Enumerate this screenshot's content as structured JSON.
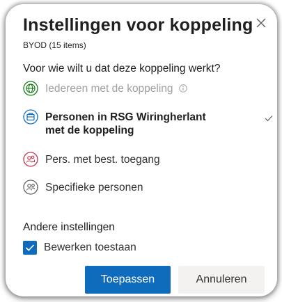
{
  "dialog": {
    "title": "Instellingen voor koppeling",
    "subtitle": "BYOD (15 items)",
    "close_icon": "close-icon"
  },
  "audience": {
    "question": "Voor wie wilt u dat deze koppeling werkt?",
    "options": [
      {
        "label": "Iedereen met de koppeling",
        "icon": "globe-icon",
        "state": "disabled",
        "has_info": true
      },
      {
        "label_line1": "Personen in RSG Wiringherlant",
        "label_line2": "met de koppeling",
        "icon": "building-icon",
        "state": "selected"
      },
      {
        "label": "Pers. met best. toegang",
        "icon": "people-access-icon",
        "state": "enabled"
      },
      {
        "label": "Specifieke personen",
        "icon": "specific-people-icon",
        "state": "enabled"
      }
    ]
  },
  "other_settings": {
    "title": "Andere instellingen",
    "allow_edit_label": "Bewerken toestaan",
    "allow_edit_checked": true
  },
  "buttons": {
    "apply_label": "Toepassen",
    "cancel_label": "Annuleren"
  },
  "colors": {
    "accent": "#0f6cbd",
    "green_icon": "#107c10",
    "blue_icon": "#0f6cbd",
    "red_icon": "#c4314b",
    "gray_icon": "#605e5c"
  }
}
